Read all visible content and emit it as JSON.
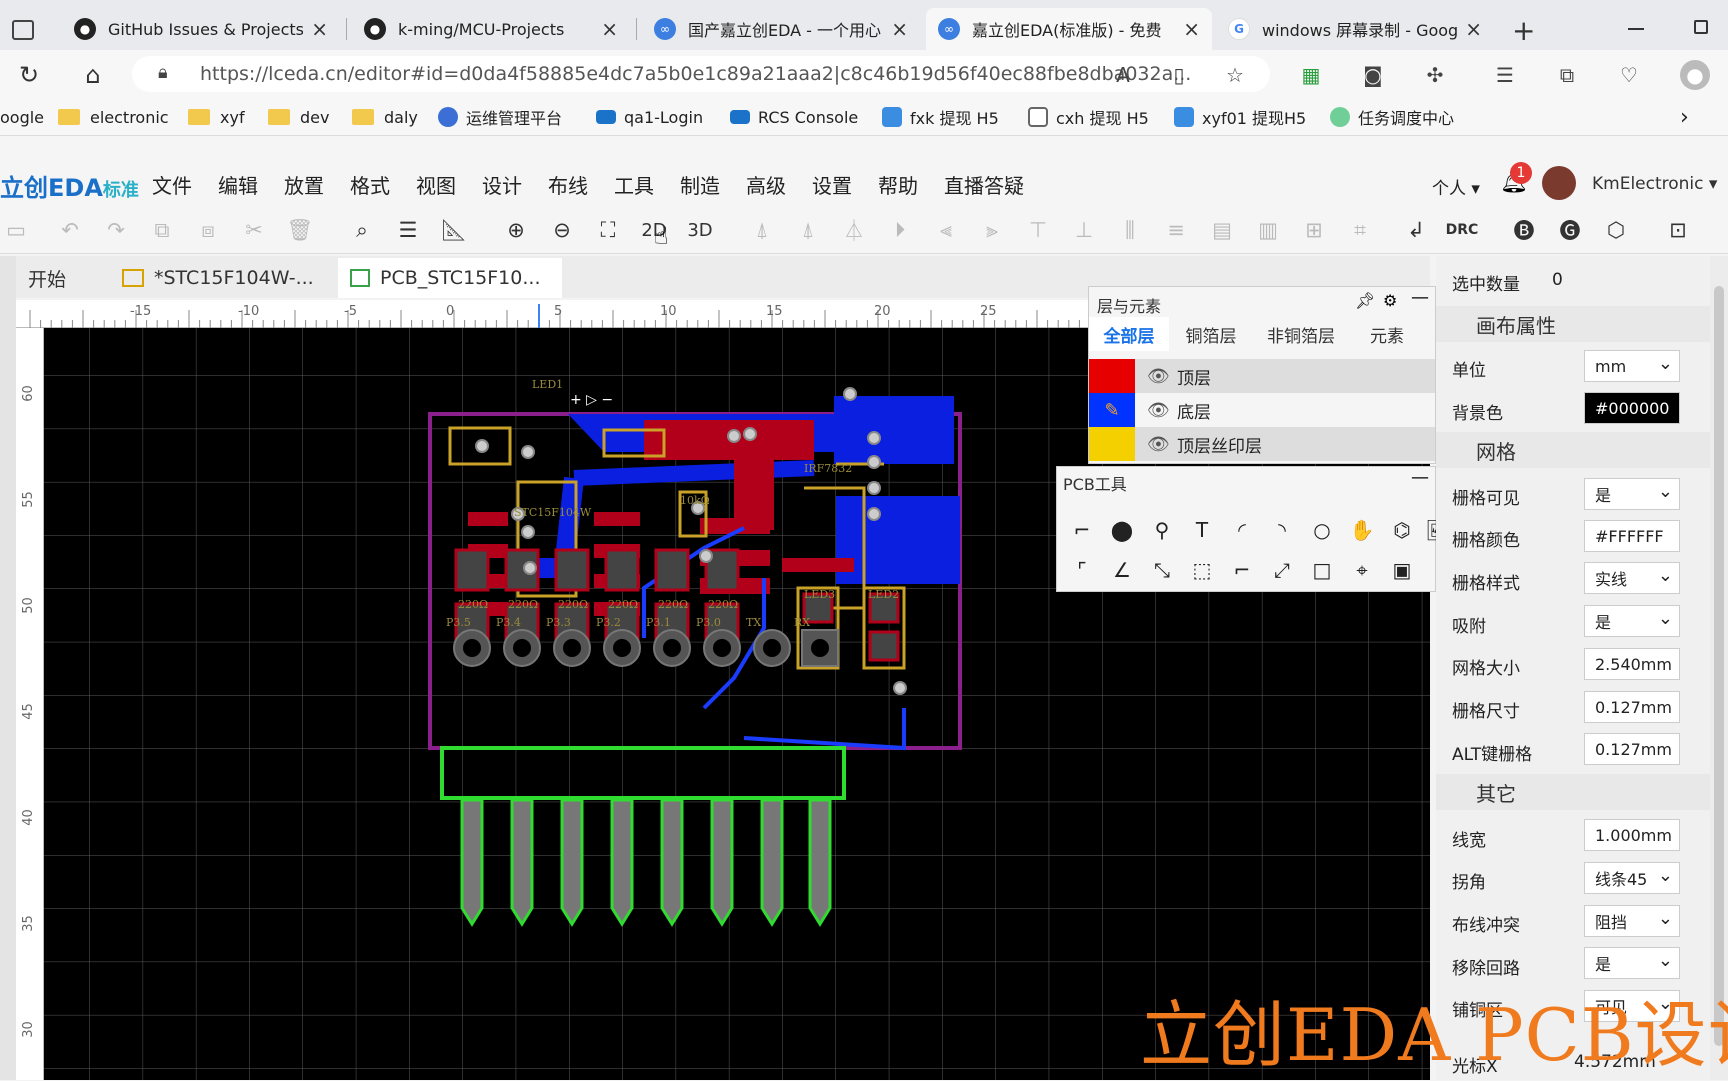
{
  "browser": {
    "tabs": [
      {
        "title": "GitHub Issues & Projects -",
        "icon": "github-icon"
      },
      {
        "title": "k-ming/MCU-Projects",
        "icon": "github-icon"
      },
      {
        "title": "国产嘉立创EDA - 一个用心",
        "icon": "lceda-icon"
      },
      {
        "title": "嘉立创EDA(标准版) - 免费",
        "icon": "lceda-icon"
      },
      {
        "title": "windows 屏幕录制 - Goog",
        "icon": "google-icon"
      }
    ],
    "new_tab": "+",
    "url": "https://lceda.cn/editor#id=d0da4f58885e4dc7a5b0e1c89a21aaa2|c8c46b19d56f40ec88fbe8dba032a...",
    "bookmarks": [
      "oogle",
      "electronic",
      "xyf",
      "dev",
      "daly",
      "运维管理平台",
      "qa1-Login",
      "RCS Console",
      "fxk 提现 H5",
      "cxh 提现 H5",
      "xyf01 提现H5",
      "任务调度中心"
    ]
  },
  "app": {
    "logo": "立创EDA",
    "logo_sub": "标准",
    "menus": [
      "文件",
      "编辑",
      "放置",
      "格式",
      "视图",
      "设计",
      "布线",
      "工具",
      "制造",
      "高级",
      "设置",
      "帮助",
      "直播答疑"
    ],
    "user_menu": "个人",
    "notification_count": "1",
    "username": "KmElectronic",
    "toolbar": {
      "view_2d": "2D",
      "view_3d": "3D",
      "drc": "DRC"
    },
    "doc_tabs": [
      "开始",
      "*STC15F104W-...",
      "PCB_STC15F10..."
    ]
  },
  "ruler": {
    "h_ticks": [
      "-15",
      "-10",
      "-5",
      "0",
      "5",
      "10",
      "15",
      "20",
      "25"
    ],
    "v_ticks": [
      "60",
      "55",
      "50",
      "45",
      "40",
      "35",
      "30"
    ]
  },
  "layers_panel": {
    "title": "层与元素",
    "tabs": [
      "全部层",
      "铜箔层",
      "非铜箔层",
      "元素"
    ],
    "layers": [
      {
        "name": "顶层",
        "color": "#e60000"
      },
      {
        "name": "底层",
        "color": "#0033ff"
      },
      {
        "name": "顶层丝印层",
        "color": "#f5d000"
      }
    ]
  },
  "pcb_tools": {
    "title": "PCB工具"
  },
  "properties": {
    "selected_label": "选中数量",
    "selected_count": "0",
    "canvas_section": "画布属性",
    "unit_label": "单位",
    "unit_value": "mm",
    "bg_label": "背景色",
    "bg_value": "#000000",
    "grid_section": "网格",
    "grid_visible_label": "栅格可见",
    "grid_visible_value": "是",
    "grid_color_label": "栅格颜色",
    "grid_color_value": "#FFFFFF",
    "grid_style_label": "栅格样式",
    "grid_style_value": "实线",
    "snap_label": "吸附",
    "snap_value": "是",
    "grid_size_label": "网格大小",
    "grid_size_value": "2.540mm",
    "grid_dim_label": "栅格尺寸",
    "grid_dim_value": "0.127mm",
    "alt_grid_label": "ALT键栅格",
    "alt_grid_value": "0.127mm",
    "other_section": "其它",
    "linewidth_label": "线宽",
    "linewidth_value": "1.000mm",
    "corner_label": "拐角",
    "corner_value": "线条45",
    "conflict_label": "布线冲突",
    "conflict_value": "阻挡",
    "remove_loop_label": "移除回路",
    "remove_loop_value": "是",
    "extra_label": "铺铜区",
    "extra_value": "可见",
    "cursor_x_label": "光标X",
    "cursor_x_value": "4.572mm"
  },
  "pcb": {
    "labels": [
      "LED1",
      "STC15F104W",
      "IRF7832",
      "10kΩ",
      "220Ω",
      "LED3",
      "LED2"
    ],
    "resistor_label": "220Ω",
    "pin_labels": [
      "P3.5",
      "P3.4",
      "P3.3",
      "P3.2",
      "P3.1",
      "P3.0",
      "TX",
      "RX"
    ]
  },
  "overlay_text": "立创EDA PCB设计"
}
